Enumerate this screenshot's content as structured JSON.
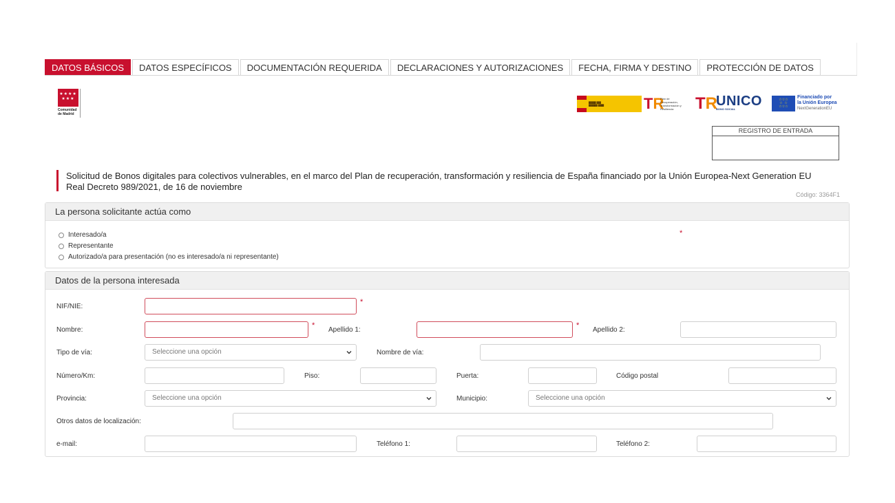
{
  "tabs": [
    {
      "label": "DATOS BÁSICOS",
      "active": true
    },
    {
      "label": "DATOS ESPECÍFICOS",
      "active": false
    },
    {
      "label": "DOCUMENTACIÓN REQUERIDA",
      "active": false
    },
    {
      "label": "DECLARACIONES Y AUTORIZACIONES",
      "active": false
    },
    {
      "label": "FECHA, FIRMA Y DESTINO",
      "active": false
    },
    {
      "label": "PROTECCIÓN DE DATOS",
      "active": false
    }
  ],
  "logos": {
    "cam_line1": "Comunidad",
    "cam_line2": "de Madrid",
    "plan_text": "Plan de Recuperación, Transformación y Resiliencia",
    "unico": "UNICO",
    "unico_sub": "BONO SOCIAL",
    "eu_line1": "Financiado por",
    "eu_line2": "la Unión Europea",
    "eu_line3": "NextGenerationEU"
  },
  "registro": {
    "label": "REGISTRO DE ENTRADA"
  },
  "title": {
    "line1": "Solicitud de Bonos digitales para colectivos vulnerables, en el marco del Plan de recuperación, transformación y resiliencia de España financiado por la Unión Europea-Next Generation EU",
    "line2": "Real Decreto 989/2021, de 16 de noviembre"
  },
  "codigo": "Código: 3364F1",
  "section_solicitante": {
    "heading": "La persona solicitante actúa como",
    "options": [
      "Interesado/a",
      "Representante",
      "Autorizado/a para presentación (no es interesado/a ni representante)"
    ]
  },
  "section_interesada": {
    "heading": "Datos de la persona interesada",
    "labels": {
      "nif": "NIF/NIE:",
      "nombre": "Nombre:",
      "apellido1": "Apellido 1:",
      "apellido2": "Apellido 2:",
      "tipo_via": "Tipo de vía:",
      "nombre_via": "Nombre de vía:",
      "numero": "Número/Km:",
      "piso": "Piso:",
      "puerta": "Puerta:",
      "codigo_postal": "Código postal",
      "provincia": "Provincia:",
      "municipio": "Municipio:",
      "otros": "Otros datos de localización:",
      "email": "e-mail:",
      "telefono1": "Teléfono 1:",
      "telefono2": "Teléfono 2:"
    },
    "select_placeholder": "Seleccione una opción",
    "required_mark": "*"
  },
  "colors": {
    "accent": "#c8102e",
    "section_bg": "#f0f0f0"
  }
}
